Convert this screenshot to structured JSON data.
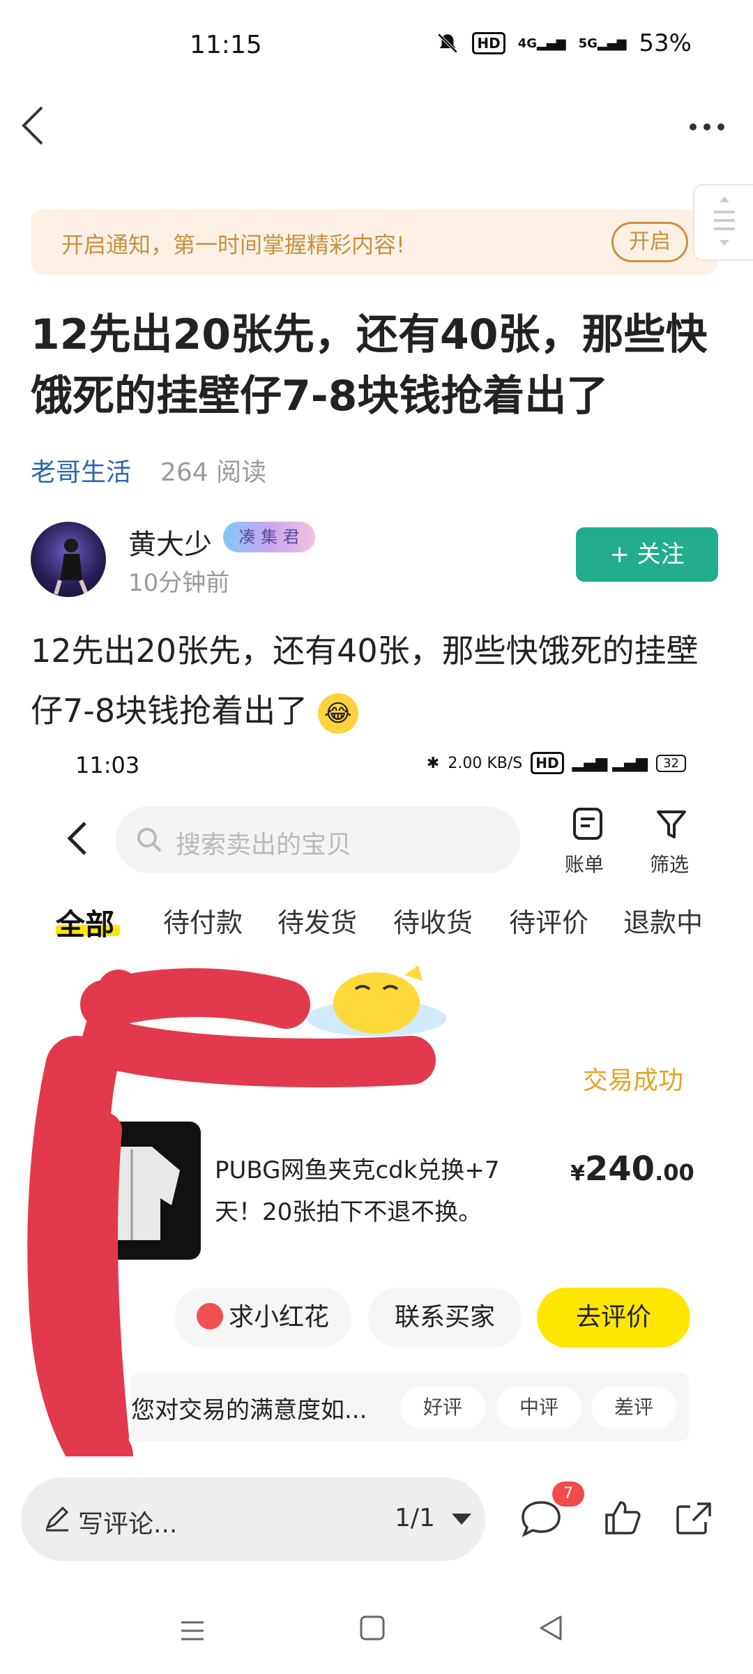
{
  "status_bar": {
    "time": "11:15",
    "network_a": "4G",
    "network_b": "5G",
    "battery": "53%"
  },
  "nav": {
    "back_icon": "chevron-left-icon",
    "more_icon": "more-dots-icon"
  },
  "notify_banner": {
    "text": "开启通知，第一时间掌握精彩内容!",
    "button": "开启"
  },
  "post": {
    "title": "12先出20张先，还有40张，那些快饿死的挂壁仔7-8块钱抢着出了",
    "channel": "老哥生活",
    "reads": "264 阅读",
    "author": {
      "name": "黄大少",
      "badge": "凑 集 君",
      "time": "10分钟前"
    },
    "follow_button": "+ 关注",
    "body": "12先出20张先，还有40张，那些快饿死的挂壁仔7-8块钱抢着出了"
  },
  "embedded_screenshot": {
    "time": "11:03",
    "speed": "2.00 KB/S",
    "battery": "32",
    "search_placeholder": "搜索卖出的宝贝",
    "bill_label": "账单",
    "filter_label": "筛选",
    "tabs": [
      "全部",
      "待付款",
      "待发货",
      "待收货",
      "待评价",
      "退款中"
    ],
    "active_tab": "全部",
    "order_status": "交易成功",
    "product_name": "PUBG网鱼夹克cdk兑换+7天！20张拍下不退不换。",
    "price_symbol": "¥",
    "price_main": "240",
    "price_decimal": ".00",
    "actions": [
      "求小红花",
      "联系买家",
      "去评价"
    ],
    "rating_prompt": "您对交易的满意度如...",
    "rating_options": [
      "好评",
      "中评",
      "差评"
    ]
  },
  "bottom_bar": {
    "comment_placeholder": "写评论...",
    "pager": "1/1",
    "comment_count": "7"
  },
  "colors": {
    "follow_green": "#21ad8c",
    "channel_blue": "#2b66b0",
    "notify_orange": "#c8903d",
    "xianyu_yellow": "#ffe600",
    "success_orange": "#e3a327",
    "scribble_red": "#e23a4c"
  }
}
